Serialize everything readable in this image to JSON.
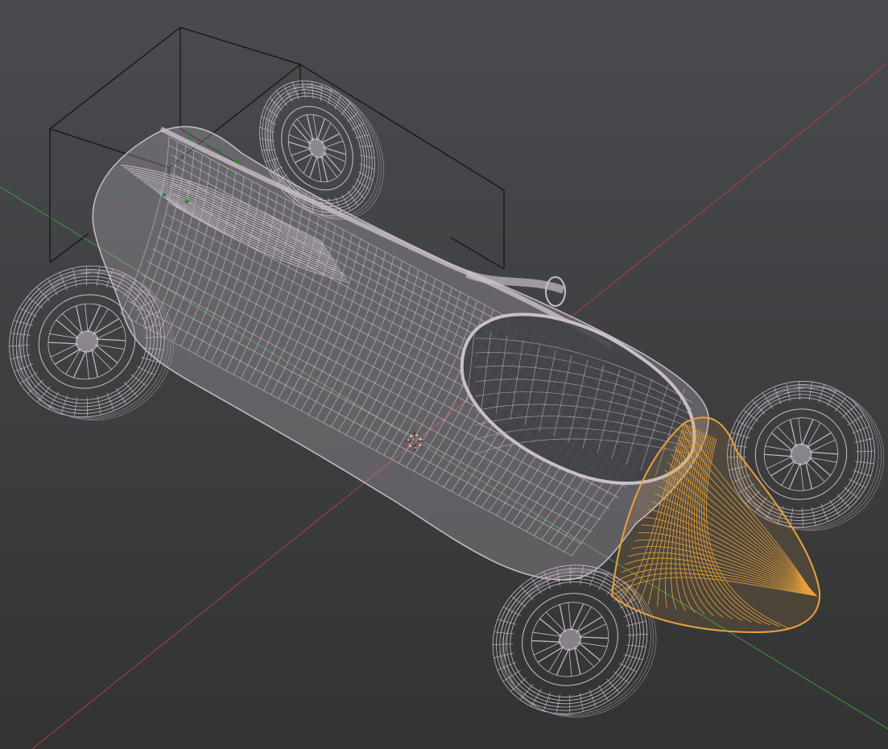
{
  "viewport": {
    "background_top": "#494b4f",
    "background_bottom": "#333333",
    "shading_mode": "wireframe",
    "projection": "perspective"
  },
  "colors": {
    "wire": "#c9bfca",
    "wire_dark": "#9d93a0",
    "selected": "#e8a23c",
    "bounding_box": "#111111",
    "axis_x": "#b0413e",
    "axis_y": "#3f9b3f",
    "empty_points": "#2f8a2f",
    "cursor_red": "#e04040",
    "cursor_white": "#eeeeee"
  },
  "scene": {
    "objects": [
      {
        "name": "body",
        "selected": false,
        "icon": "wireframe-mesh"
      },
      {
        "name": "nose-cone",
        "selected": true,
        "icon": "wireframe-mesh"
      },
      {
        "name": "wheel-front-left",
        "selected": false,
        "icon": "wheel-mesh"
      },
      {
        "name": "wheel-front-right",
        "selected": false,
        "icon": "wheel-mesh"
      },
      {
        "name": "wheel-rear-left",
        "selected": false,
        "icon": "wheel-mesh"
      },
      {
        "name": "wheel-rear-right",
        "selected": false,
        "icon": "wheel-mesh"
      },
      {
        "name": "bounding-box",
        "selected": false,
        "icon": "cube-outline"
      },
      {
        "name": "3d-cursor",
        "selected": false,
        "icon": "crosshair-icon"
      }
    ]
  }
}
